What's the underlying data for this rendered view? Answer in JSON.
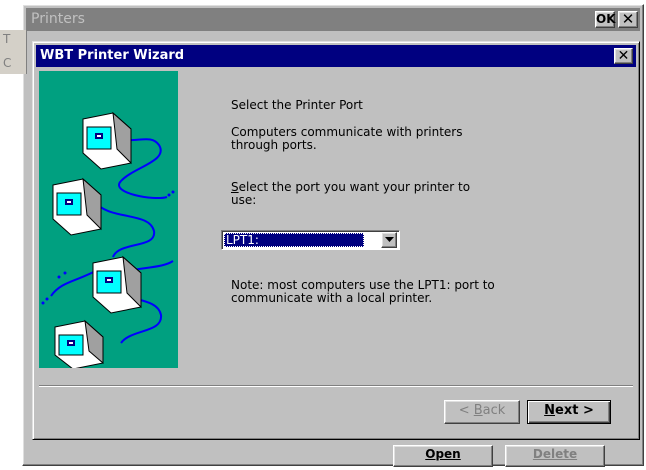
{
  "background_window": {
    "title": "Printers",
    "ok_label": "OK",
    "close_label": "✕",
    "strip_letters": [
      "T",
      "C"
    ],
    "open_label": "Open",
    "delete_label": "Delete"
  },
  "wizard": {
    "title": "WBT Printer Wizard",
    "close_label": "✕",
    "heading": "Select the Printer Port",
    "description": "Computers communicate with printers through ports.",
    "select_prompt_underlined": "S",
    "select_prompt_rest": "elect the port you want your printer to use:",
    "port_value": "LPT1:",
    "note": "Note: most computers use the LPT1: port to communicate with a local printer.",
    "back_prefix": "< ",
    "back_underlined": "B",
    "back_rest": "ack",
    "next_underlined": "N",
    "next_rest": "ext >"
  },
  "colors": {
    "titlebar_active": "#000080",
    "titlebar_inactive": "#808080",
    "illustration_bg": "#00a080",
    "cable": "#0000ff",
    "dialog_face": "#c0c0c0"
  }
}
